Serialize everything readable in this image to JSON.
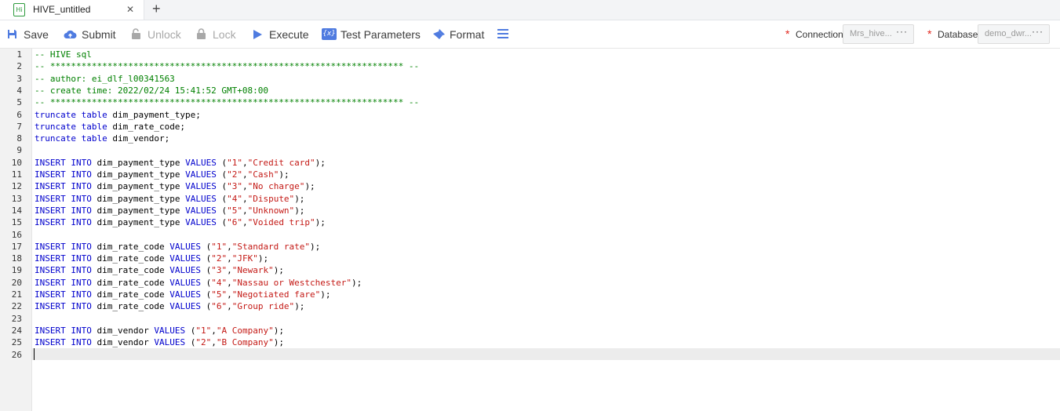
{
  "tab": {
    "title": "HIVE_untitled",
    "icon_text": "Hi",
    "close": "✕",
    "add": "+"
  },
  "toolbar": {
    "save": "Save",
    "submit": "Submit",
    "unlock": "Unlock",
    "lock": "Lock",
    "execute": "Execute",
    "test_parameters": "Test Parameters",
    "format": "Format",
    "test_icon": "{x}",
    "connection_label": "Connection",
    "connection_value": "Mrs_hive...",
    "database_label": "Database",
    "database_value": "demo_dwr...",
    "required_mark": "*",
    "more": "···"
  },
  "editor": {
    "lines": [
      [
        {
          "t": "cm",
          "v": "-- HIVE sql"
        }
      ],
      [
        {
          "t": "cm",
          "v": "-- ******************************************************************** --"
        }
      ],
      [
        {
          "t": "cm",
          "v": "-- author: ei_dlf_l00341563"
        }
      ],
      [
        {
          "t": "cm",
          "v": "-- create time: 2022/02/24 15:41:52 GMT+08:00"
        }
      ],
      [
        {
          "t": "cm",
          "v": "-- ******************************************************************** --"
        }
      ],
      [
        {
          "t": "kw",
          "v": "truncate table"
        },
        {
          "t": "p",
          "v": " dim_payment_type;"
        }
      ],
      [
        {
          "t": "kw",
          "v": "truncate table"
        },
        {
          "t": "p",
          "v": " dim_rate_code;"
        }
      ],
      [
        {
          "t": "kw",
          "v": "truncate table"
        },
        {
          "t": "p",
          "v": " dim_vendor;"
        }
      ],
      [],
      [
        {
          "t": "kw",
          "v": "INSERT INTO"
        },
        {
          "t": "p",
          "v": " dim_payment_type "
        },
        {
          "t": "kw",
          "v": "VALUES"
        },
        {
          "t": "p",
          "v": " ("
        },
        {
          "t": "str",
          "v": "\"1\""
        },
        {
          "t": "p",
          "v": ","
        },
        {
          "t": "str",
          "v": "\"Credit card\""
        },
        {
          "t": "p",
          "v": ");"
        }
      ],
      [
        {
          "t": "kw",
          "v": "INSERT INTO"
        },
        {
          "t": "p",
          "v": " dim_payment_type "
        },
        {
          "t": "kw",
          "v": "VALUES"
        },
        {
          "t": "p",
          "v": " ("
        },
        {
          "t": "str",
          "v": "\"2\""
        },
        {
          "t": "p",
          "v": ","
        },
        {
          "t": "str",
          "v": "\"Cash\""
        },
        {
          "t": "p",
          "v": ");"
        }
      ],
      [
        {
          "t": "kw",
          "v": "INSERT INTO"
        },
        {
          "t": "p",
          "v": " dim_payment_type "
        },
        {
          "t": "kw",
          "v": "VALUES"
        },
        {
          "t": "p",
          "v": " ("
        },
        {
          "t": "str",
          "v": "\"3\""
        },
        {
          "t": "p",
          "v": ","
        },
        {
          "t": "str",
          "v": "\"No charge\""
        },
        {
          "t": "p",
          "v": ");"
        }
      ],
      [
        {
          "t": "kw",
          "v": "INSERT INTO"
        },
        {
          "t": "p",
          "v": " dim_payment_type "
        },
        {
          "t": "kw",
          "v": "VALUES"
        },
        {
          "t": "p",
          "v": " ("
        },
        {
          "t": "str",
          "v": "\"4\""
        },
        {
          "t": "p",
          "v": ","
        },
        {
          "t": "str",
          "v": "\"Dispute\""
        },
        {
          "t": "p",
          "v": ");"
        }
      ],
      [
        {
          "t": "kw",
          "v": "INSERT INTO"
        },
        {
          "t": "p",
          "v": " dim_payment_type "
        },
        {
          "t": "kw",
          "v": "VALUES"
        },
        {
          "t": "p",
          "v": " ("
        },
        {
          "t": "str",
          "v": "\"5\""
        },
        {
          "t": "p",
          "v": ","
        },
        {
          "t": "str",
          "v": "\"Unknown\""
        },
        {
          "t": "p",
          "v": ");"
        }
      ],
      [
        {
          "t": "kw",
          "v": "INSERT INTO"
        },
        {
          "t": "p",
          "v": " dim_payment_type "
        },
        {
          "t": "kw",
          "v": "VALUES"
        },
        {
          "t": "p",
          "v": " ("
        },
        {
          "t": "str",
          "v": "\"6\""
        },
        {
          "t": "p",
          "v": ","
        },
        {
          "t": "str",
          "v": "\"Voided trip\""
        },
        {
          "t": "p",
          "v": ");"
        }
      ],
      [],
      [
        {
          "t": "kw",
          "v": "INSERT INTO"
        },
        {
          "t": "p",
          "v": " dim_rate_code "
        },
        {
          "t": "kw",
          "v": "VALUES"
        },
        {
          "t": "p",
          "v": " ("
        },
        {
          "t": "str",
          "v": "\"1\""
        },
        {
          "t": "p",
          "v": ","
        },
        {
          "t": "str",
          "v": "\"Standard rate\""
        },
        {
          "t": "p",
          "v": ");"
        }
      ],
      [
        {
          "t": "kw",
          "v": "INSERT INTO"
        },
        {
          "t": "p",
          "v": " dim_rate_code "
        },
        {
          "t": "kw",
          "v": "VALUES"
        },
        {
          "t": "p",
          "v": " ("
        },
        {
          "t": "str",
          "v": "\"2\""
        },
        {
          "t": "p",
          "v": ","
        },
        {
          "t": "str",
          "v": "\"JFK\""
        },
        {
          "t": "p",
          "v": ");"
        }
      ],
      [
        {
          "t": "kw",
          "v": "INSERT INTO"
        },
        {
          "t": "p",
          "v": " dim_rate_code "
        },
        {
          "t": "kw",
          "v": "VALUES"
        },
        {
          "t": "p",
          "v": " ("
        },
        {
          "t": "str",
          "v": "\"3\""
        },
        {
          "t": "p",
          "v": ","
        },
        {
          "t": "str",
          "v": "\"Newark\""
        },
        {
          "t": "p",
          "v": ");"
        }
      ],
      [
        {
          "t": "kw",
          "v": "INSERT INTO"
        },
        {
          "t": "p",
          "v": " dim_rate_code "
        },
        {
          "t": "kw",
          "v": "VALUES"
        },
        {
          "t": "p",
          "v": " ("
        },
        {
          "t": "str",
          "v": "\"4\""
        },
        {
          "t": "p",
          "v": ","
        },
        {
          "t": "str",
          "v": "\"Nassau or Westchester\""
        },
        {
          "t": "p",
          "v": ");"
        }
      ],
      [
        {
          "t": "kw",
          "v": "INSERT INTO"
        },
        {
          "t": "p",
          "v": " dim_rate_code "
        },
        {
          "t": "kw",
          "v": "VALUES"
        },
        {
          "t": "p",
          "v": " ("
        },
        {
          "t": "str",
          "v": "\"5\""
        },
        {
          "t": "p",
          "v": ","
        },
        {
          "t": "str",
          "v": "\"Negotiated fare\""
        },
        {
          "t": "p",
          "v": ");"
        }
      ],
      [
        {
          "t": "kw",
          "v": "INSERT INTO"
        },
        {
          "t": "p",
          "v": " dim_rate_code "
        },
        {
          "t": "kw",
          "v": "VALUES"
        },
        {
          "t": "p",
          "v": " ("
        },
        {
          "t": "str",
          "v": "\"6\""
        },
        {
          "t": "p",
          "v": ","
        },
        {
          "t": "str",
          "v": "\"Group ride\""
        },
        {
          "t": "p",
          "v": ");"
        }
      ],
      [],
      [
        {
          "t": "kw",
          "v": "INSERT INTO"
        },
        {
          "t": "p",
          "v": " dim_vendor "
        },
        {
          "t": "kw",
          "v": "VALUES"
        },
        {
          "t": "p",
          "v": " ("
        },
        {
          "t": "str",
          "v": "\"1\""
        },
        {
          "t": "p",
          "v": ","
        },
        {
          "t": "str",
          "v": "\"A Company\""
        },
        {
          "t": "p",
          "v": ");"
        }
      ],
      [
        {
          "t": "kw",
          "v": "INSERT INTO"
        },
        {
          "t": "p",
          "v": " dim_vendor "
        },
        {
          "t": "kw",
          "v": "VALUES"
        },
        {
          "t": "p",
          "v": " ("
        },
        {
          "t": "str",
          "v": "\"2\""
        },
        {
          "t": "p",
          "v": ","
        },
        {
          "t": "str",
          "v": "\"B Company\""
        },
        {
          "t": "p",
          "v": ");"
        }
      ],
      []
    ]
  }
}
